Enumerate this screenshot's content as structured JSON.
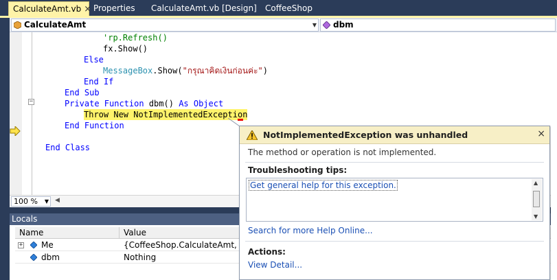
{
  "tabs": [
    {
      "label": "CalculateAmt.vb",
      "active": true,
      "close": "×"
    },
    {
      "label": "Properties"
    },
    {
      "label": "CalculateAmt.vb [Design]"
    },
    {
      "label": "CoffeeShop"
    }
  ],
  "navbar": {
    "class_combo": "CalculateAmt",
    "member_combo": "dbm"
  },
  "code_lines": [
    {
      "t1": "'rp.Refresh()"
    },
    {
      "t1": "fx.Show()"
    },
    {
      "kw": "Else"
    },
    {
      "ty": "MessageBox",
      "rest": ".Show(",
      "str": "\"กรุณาคิดเงินก่อนค่ะ\"",
      "end": ")"
    },
    {
      "kw": "End If"
    },
    {
      "kw": "End Sub"
    },
    {
      "kw1": "Private Function ",
      "name": "dbm() ",
      "kw2": "As Object"
    },
    {
      "hl": "Throw New NotImplementedException"
    },
    {
      "kw": "End Function"
    },
    {
      "kw": "End Class"
    }
  ],
  "fold_minus": "−",
  "zoom": {
    "value": "100 %"
  },
  "locals": {
    "title": "Locals",
    "columns": [
      "Name",
      "Value"
    ],
    "rows": [
      {
        "expander": "+",
        "name": "Me",
        "value": "{CoffeeShop.CalculateAmt, Text"
      },
      {
        "name": "dbm",
        "value": "Nothing"
      }
    ]
  },
  "exception": {
    "title": "NotImplementedException was unhandled",
    "close": "×",
    "message": "The method or operation is not implemented.",
    "tips_label": "Troubleshooting tips:",
    "tip_link": "Get general help for this exception.",
    "search_link": "Search for more Help Online...",
    "actions_label": "Actions:",
    "view_detail": "View Detail..."
  },
  "colors": {
    "tab_active": "#fff3a8",
    "highlight": "#fff36b",
    "keyword": "#0000ff",
    "type": "#2b91af",
    "string": "#a31515"
  }
}
